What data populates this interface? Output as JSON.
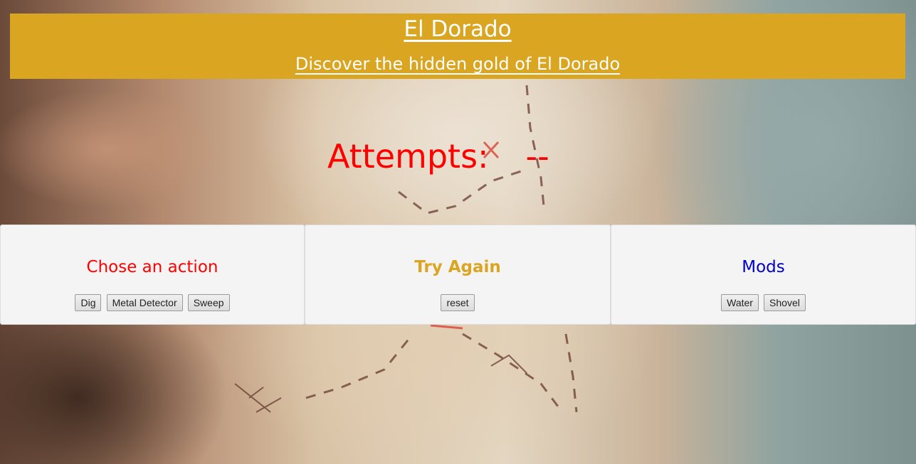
{
  "header": {
    "title": "El Dorado",
    "subtitle": "Discover the hidden gold of El Dorado",
    "background_color": "#daa520"
  },
  "status": {
    "attempts_label": "Attempts:",
    "attempts_value": "--",
    "color": "#ff0000"
  },
  "panels": {
    "actions": {
      "heading": "Chose an action",
      "heading_color": "#ff0000",
      "buttons": [
        "Dig",
        "Metal Detector",
        "Sweep"
      ]
    },
    "try_again": {
      "heading": "Try Again",
      "heading_color": "#daa520",
      "buttons": [
        "reset"
      ]
    },
    "mods": {
      "heading": "Mods",
      "heading_color": "#0000cd",
      "buttons": [
        "Water",
        "Shovel"
      ]
    }
  }
}
